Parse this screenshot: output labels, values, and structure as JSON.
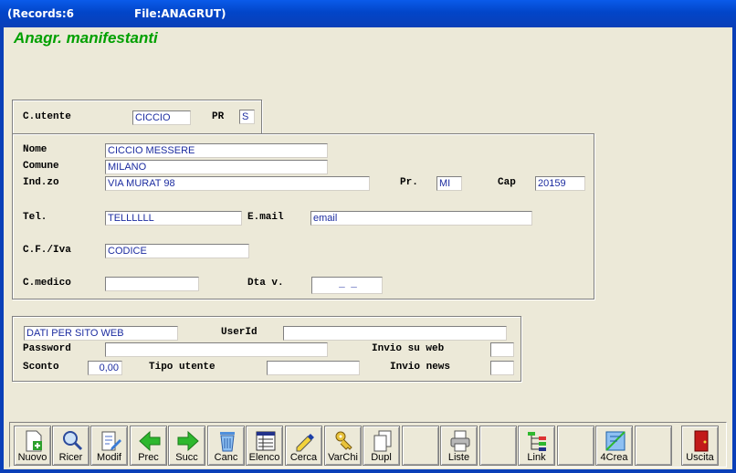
{
  "window": {
    "records": "(Records:6",
    "file": "File:ANAGRUT)"
  },
  "form_title": "Anagr. manifestanti",
  "utente": {
    "label": "C.utente",
    "value": "CICCIO",
    "pr_label": "PR",
    "pr_value": "S"
  },
  "anagrafica": {
    "nome_label": "Nome",
    "nome": "CICCIO MESSERE",
    "comune_label": "Comune",
    "comune": "MILANO",
    "indirizzo_label": "Ind.zo",
    "indirizzo": "VIA MURAT 98",
    "prov_label": "Pr.",
    "prov": "MI",
    "cap_label": "Cap",
    "cap": "20159",
    "tel_label": "Tel.",
    "tel": "TELLLLLL",
    "email_label": "E.mail",
    "email": "email",
    "cf_label": "C.F./Iva",
    "cf": "CODICE",
    "medico_label": "C.medico",
    "medico": "",
    "dtav_label": "Dta v.",
    "dtav": "_ _"
  },
  "web": {
    "section_label": "DATI PER SITO WEB",
    "userid_label": "UserId",
    "userid": "",
    "password_label": "Password",
    "password": "",
    "invio_web_label": "Invio su web",
    "invio_web": "",
    "sconto_label": "Sconto",
    "sconto": "0,00",
    "tipo_label": "Tipo utente",
    "tipo": "",
    "invio_news_label": "Invio news",
    "invio_news": ""
  },
  "toolbar": {
    "nuovo": "Nuovo",
    "ricer": "Ricer",
    "modif": "Modif",
    "prec": "Prec",
    "succ": "Succ",
    "canc": "Canc",
    "elenco": "Elenco",
    "cerca": "Cerca",
    "varchi": "VarChi",
    "dupl": "Dupl",
    "liste": "Liste",
    "link": "Link",
    "crea": "4Crea",
    "uscita": "Uscita"
  }
}
